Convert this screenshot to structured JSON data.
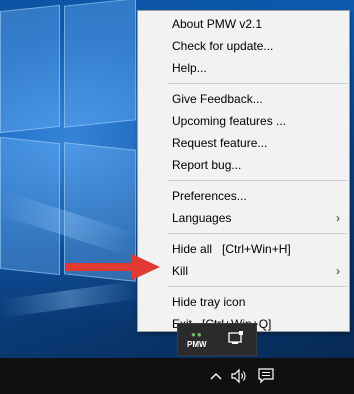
{
  "menu": {
    "groups": [
      [
        {
          "label": "About PMW v2.1"
        },
        {
          "label": "Check for update..."
        },
        {
          "label": "Help..."
        }
      ],
      [
        {
          "label": "Give Feedback..."
        },
        {
          "label": "Upcoming features ..."
        },
        {
          "label": "Request feature..."
        },
        {
          "label": "Report bug..."
        }
      ],
      [
        {
          "label": "Preferences..."
        },
        {
          "label": "Languages",
          "submenu": true
        }
      ],
      [
        {
          "label": "Hide all",
          "shortcut": "[Ctrl+Win+H]"
        },
        {
          "label": "Kill",
          "submenu": true
        }
      ],
      [
        {
          "label": "Hide tray icon"
        },
        {
          "label": "Exit",
          "shortcut": "[Ctrl+Win+Q]"
        }
      ]
    ],
    "chevron": "›"
  },
  "tray_popup": {
    "app_icon_text": "PMW",
    "app_icon_dots": "●●",
    "icons": [
      "pmw-tray-icon",
      "display-tray-icon"
    ]
  },
  "taskbar": {
    "icons": [
      "chevron-up-icon",
      "speaker-icon",
      "action-center-icon"
    ]
  },
  "colors": {
    "arrow": "#e03a33",
    "menu_bg": "#f2f2f2",
    "taskbar_bg": "#101010"
  }
}
